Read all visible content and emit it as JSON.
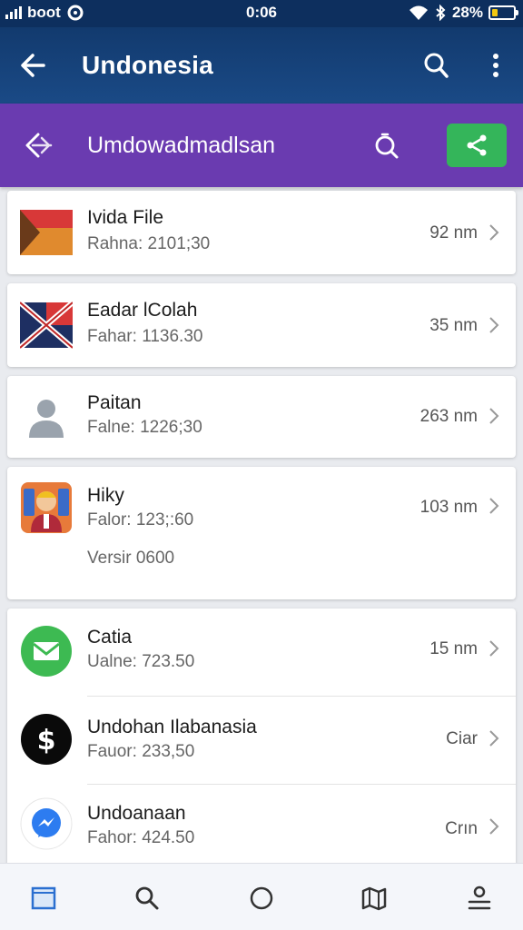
{
  "status_bar": {
    "carrier": "boot",
    "time": "0:06",
    "battery": "28%",
    "battery_level": 0.28
  },
  "app_bar": {
    "title": "Undonesia",
    "icons": [
      "back-arrow-icon",
      "search-icon",
      "more-vert-icon"
    ]
  },
  "sub_bar": {
    "title": "Umdowadmadlsan",
    "icons": [
      "back-icon",
      "search-icon",
      "share-icon"
    ],
    "share_color": "#34b55a"
  },
  "list": [
    {
      "name": "Ivida File",
      "sub": "Rahna: 2101;30",
      "value": "92 nm",
      "icon": "flag-icon"
    },
    {
      "name": "Eadar lColah",
      "sub": "Fahar: 1136.30",
      "value": "35 nm",
      "icon": "flag-icon"
    },
    {
      "name": "Paitan",
      "sub": "Falne: 1226;30",
      "value": "263 nm",
      "icon": "person-icon"
    },
    {
      "name": "Hiky",
      "sub": "Falor: 123;:60",
      "value": "103 nm",
      "extra": "Versir 0600",
      "icon": "avatar-icon"
    },
    {
      "name": "Catia",
      "sub": "Ualne: 723.50",
      "value": "15 nm",
      "icon": "message-icon"
    },
    {
      "name": "Undohan Ilabanasia",
      "sub": "Fauor: 233,50",
      "value": "Ciar",
      "icon": "dollar-icon"
    },
    {
      "name": "Undoanaan",
      "sub": "Fahor: 424.50",
      "value": "Crın",
      "icon": "messenger-icon"
    }
  ],
  "bottom_nav": [
    "home-icon",
    "search-icon",
    "circle-icon",
    "map-icon",
    "profile-icon"
  ],
  "colors": {
    "app_bar": "#143c70",
    "sub_bar": "#6a3bb0",
    "accent_green": "#34b55a"
  }
}
